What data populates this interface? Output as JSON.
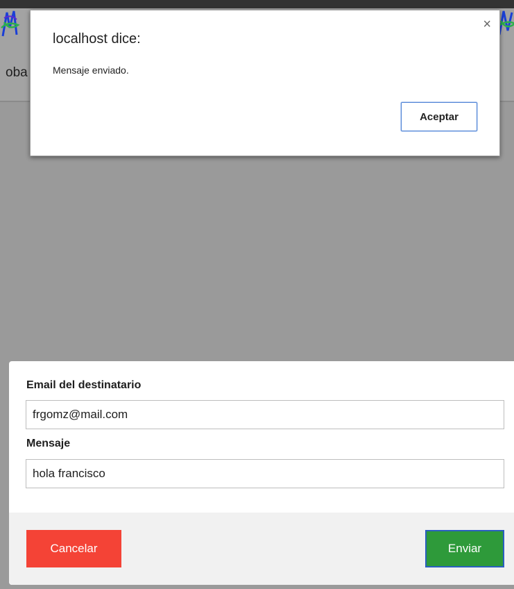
{
  "header": {
    "text_fragment": "oba"
  },
  "alert": {
    "title": "localhost dice:",
    "message": "Mensaje enviado.",
    "close_glyph": "×",
    "ok_label": "Aceptar"
  },
  "form": {
    "email_label": "Email del destinatario",
    "email_value": "frgomz@mail.com",
    "message_label": "Mensaje",
    "message_value": "hola francisco",
    "cancel_label": "Cancelar",
    "send_label": "Enviar"
  },
  "colors": {
    "overlay": "#9a9a9a",
    "cancel": "#f44336",
    "send": "#2e9a3a",
    "focus_border": "#4a7fd4"
  },
  "icons": {
    "logo": "scribble-logo-icon",
    "close": "close-icon"
  }
}
